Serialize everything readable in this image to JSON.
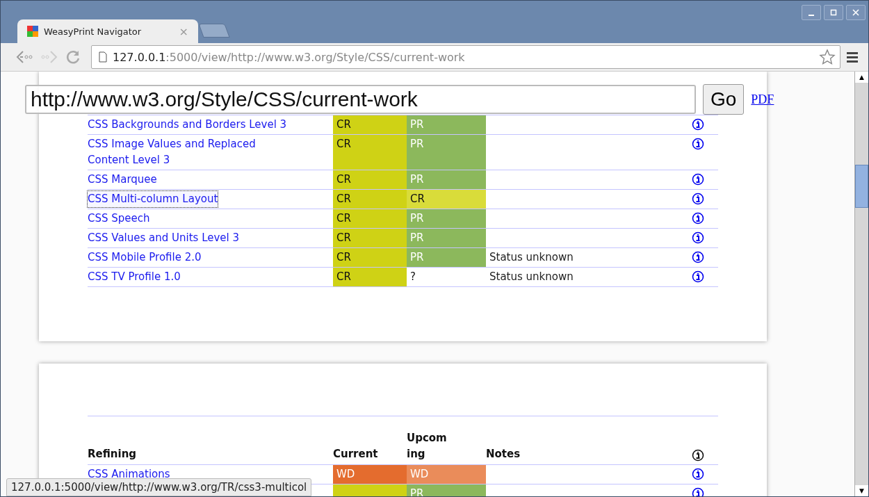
{
  "window": {
    "tab_title": "WeasyPrint Navigator",
    "tab_close": "×",
    "address_host": "127.0.0.1",
    "address_rest": ":5000/view/http://www.w3.org/Style/CSS/current-work"
  },
  "form": {
    "url": "http://www.w3.org/Style/CSS/current-work",
    "go": "Go",
    "pdf": "PDF"
  },
  "pages": [
    {
      "rows": [
        {
          "name": "CSS Backgrounds and Borders Level 3",
          "focused": false,
          "current": {
            "text": "CR",
            "color": "#cfd215"
          },
          "upcoming": {
            "text": "PR",
            "color": "#8cb85c"
          }
        },
        {
          "name": "CSS Image Values and Replaced Content Level 3",
          "focused": false,
          "current": {
            "text": "CR",
            "color": "#cfd215"
          },
          "upcoming": {
            "text": "PR",
            "color": "#8cb85c"
          }
        },
        {
          "name": "CSS Marquee",
          "focused": false,
          "current": {
            "text": "CR",
            "color": "#cfd215"
          },
          "upcoming": {
            "text": "PR",
            "color": "#8cb85c"
          }
        },
        {
          "name": "CSS Multi-column Layout",
          "focused": true,
          "current": {
            "text": "CR",
            "color": "#cfd215"
          },
          "upcoming": {
            "text": "CR",
            "color": "#d9dc3a"
          }
        },
        {
          "name": "CSS Speech",
          "focused": false,
          "current": {
            "text": "CR",
            "color": "#cfd215"
          },
          "upcoming": {
            "text": "PR",
            "color": "#8cb85c"
          }
        },
        {
          "name": "CSS Values and Units Level 3",
          "focused": false,
          "current": {
            "text": "CR",
            "color": "#cfd215"
          },
          "upcoming": {
            "text": "PR",
            "color": "#8cb85c"
          }
        },
        {
          "name": "CSS Mobile Profile 2.0",
          "focused": false,
          "current": {
            "text": "CR",
            "color": "#cfd215"
          },
          "upcoming": {
            "text": "PR",
            "color": "#8cb85c"
          },
          "notes": "Status unknown"
        },
        {
          "name": "CSS TV Profile 1.0",
          "focused": false,
          "current": {
            "text": "CR",
            "color": "#cfd215"
          },
          "upcoming": {
            "text": "?",
            "color": "#ffffff"
          },
          "notes": "Status unknown"
        }
      ]
    },
    {
      "columns": [
        "Refining",
        "Current",
        "Upcom\ning",
        "Notes"
      ],
      "rows": [
        {
          "name": "CSS Animations",
          "focused": false,
          "current": {
            "text": "WD",
            "color": "#e46c2e"
          },
          "upcoming": {
            "text": "WD",
            "color": "#ea8c5a"
          }
        },
        {
          "current": {
            "color": "#cfd215"
          },
          "upcoming": {
            "text": "PR",
            "color": "#8cb85c"
          }
        }
      ]
    }
  ],
  "scroll_up": "▲",
  "scroll_down": "▼",
  "status_bar": "127.0.0.1:5000/view/http://www.w3.org/TR/css3-multicol"
}
